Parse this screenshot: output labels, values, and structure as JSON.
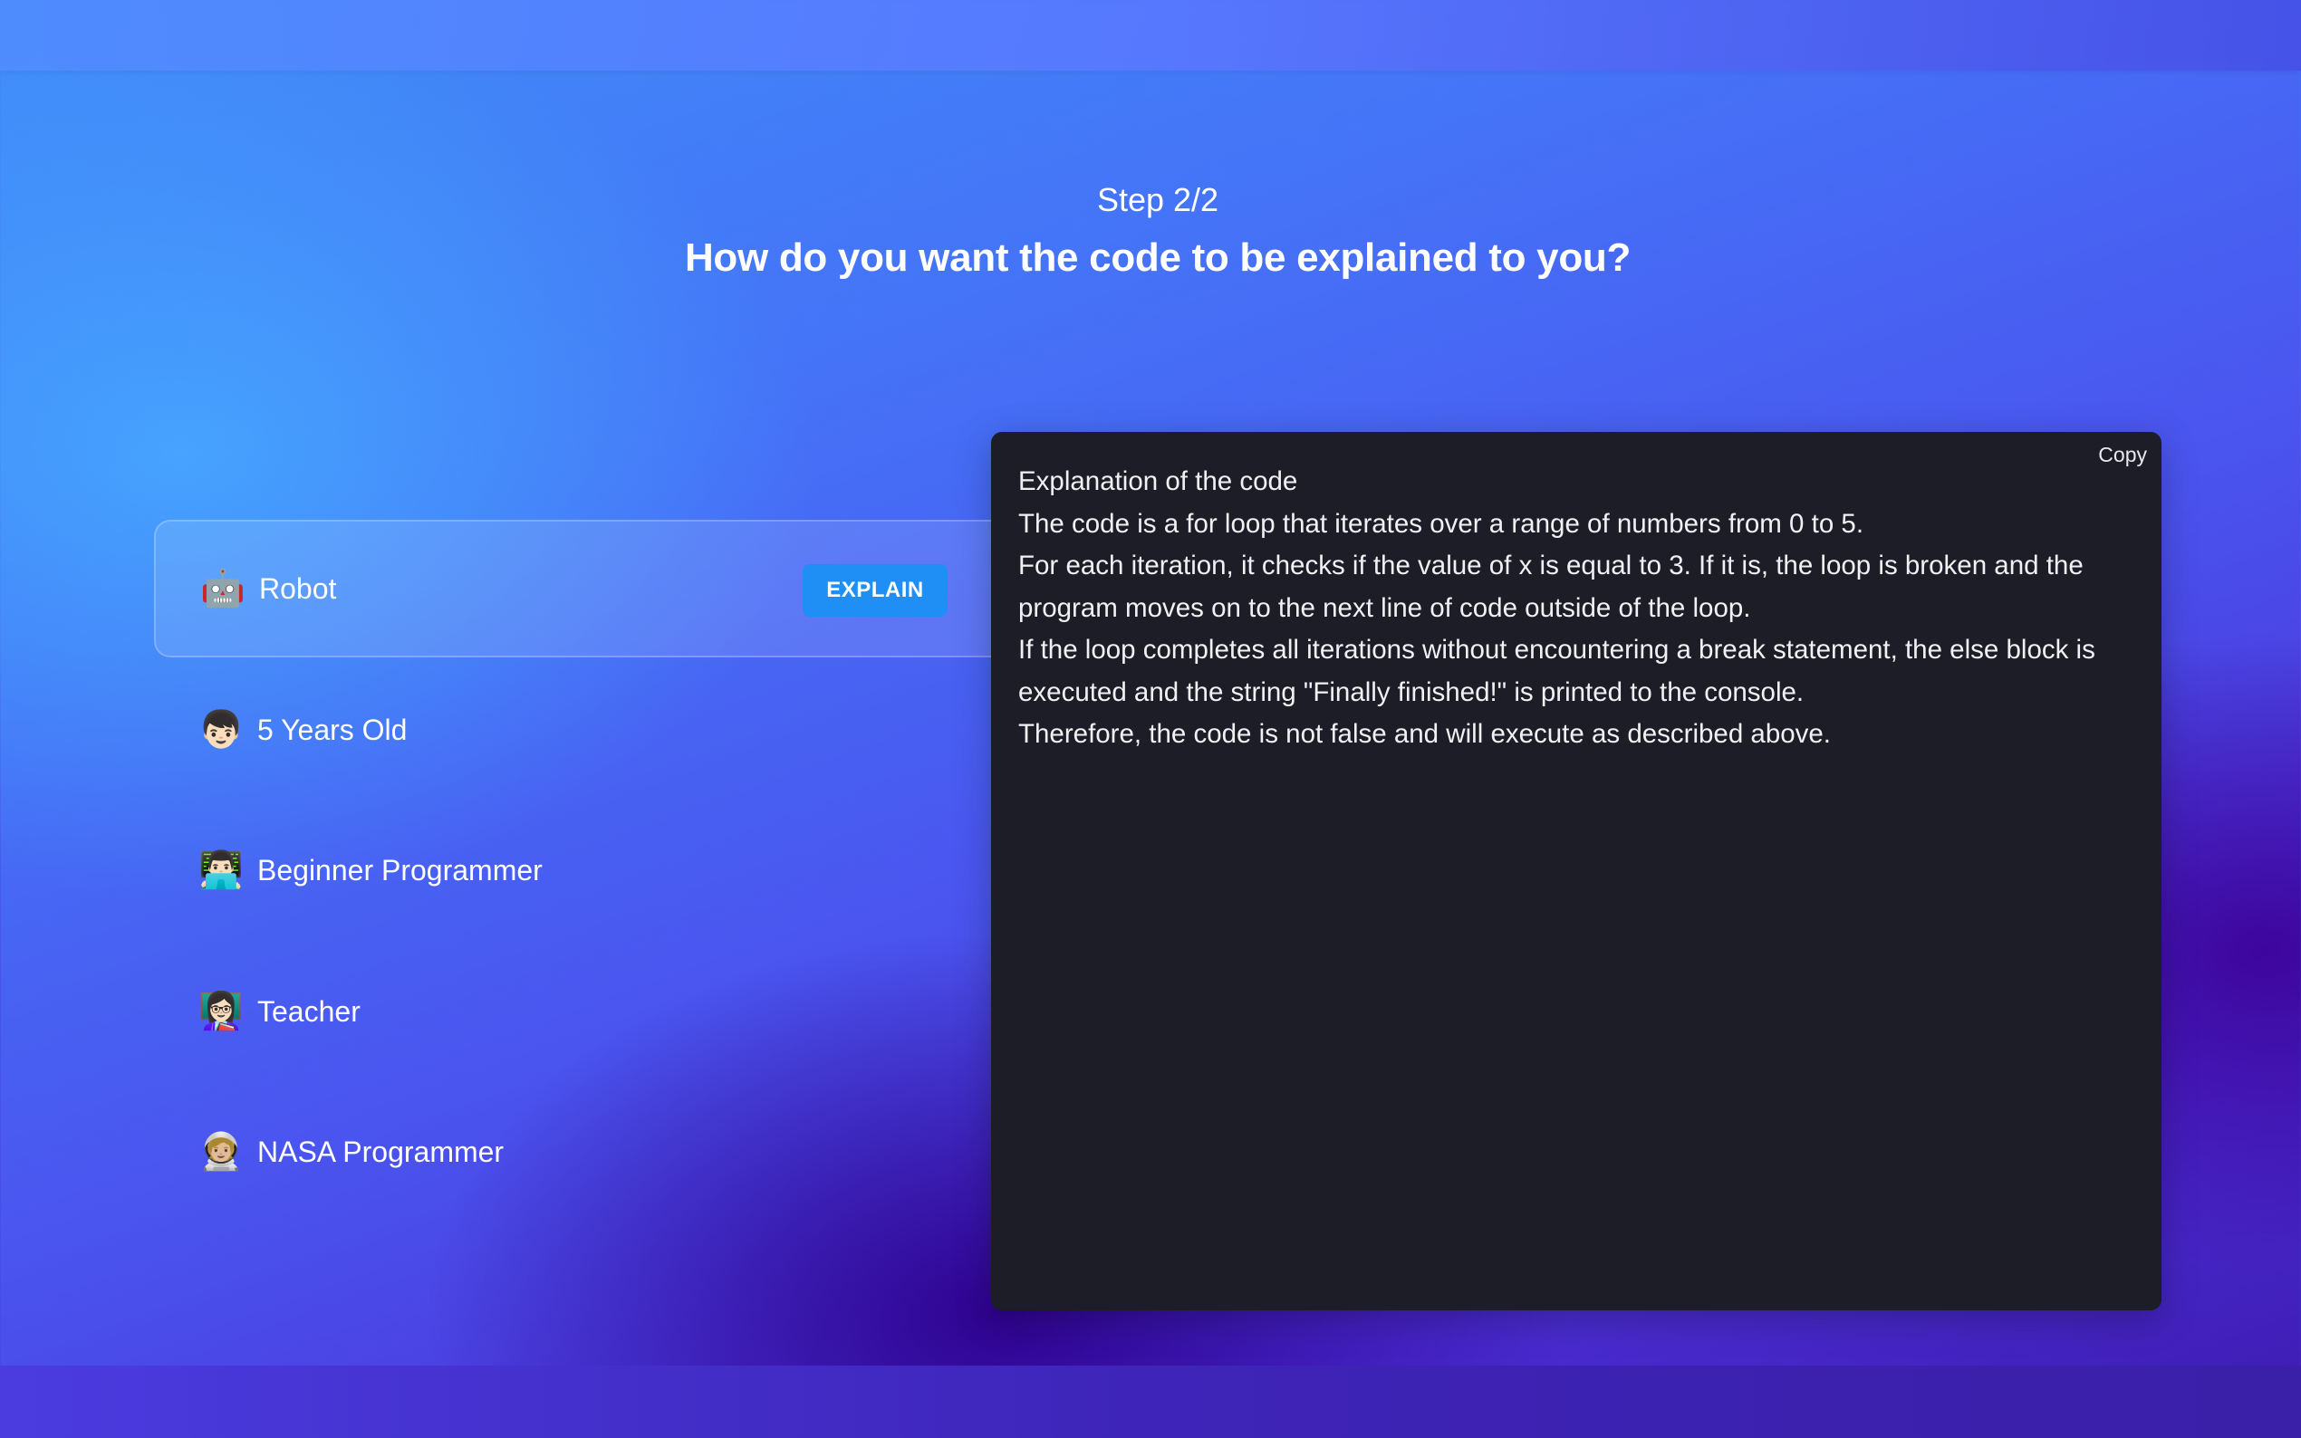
{
  "header": {
    "step": "Step 2/2",
    "question": "How do you want the code to be explained to you?"
  },
  "options": [
    {
      "emoji": "🤖",
      "label": "Robot",
      "selected": true
    },
    {
      "emoji": "👦🏻",
      "label": "5 Years Old",
      "selected": false
    },
    {
      "emoji": "👨🏻‍💻",
      "label": "Beginner Programmer",
      "selected": false
    },
    {
      "emoji": "👩🏻‍🏫",
      "label": "Teacher",
      "selected": false
    },
    {
      "emoji": "🧑🏼‍🚀",
      "label": "NASA Programmer",
      "selected": false
    }
  ],
  "explain_button": "EXPLAIN",
  "output": {
    "copy_label": "Copy",
    "text": "Explanation of the code\nThe code is a for loop that iterates over a range of numbers from 0 to 5.\nFor each iteration, it checks if the value of x is equal to 3. If it is, the loop is broken and the program moves on to the next line of code outside of the loop.\nIf the loop completes all iterations without encountering a break statement, the else block is executed and the string \"Finally finished!\" is printed to the console.\nTherefore, the code is not false and will execute as described above."
  },
  "colors": {
    "accent_button": "#1f8ef5",
    "panel_background": "#1c1d27",
    "text_primary": "#ffffff"
  },
  "icons": [
    "robot-icon",
    "boy-icon",
    "programmer-icon",
    "teacher-icon",
    "astronaut-icon"
  ]
}
